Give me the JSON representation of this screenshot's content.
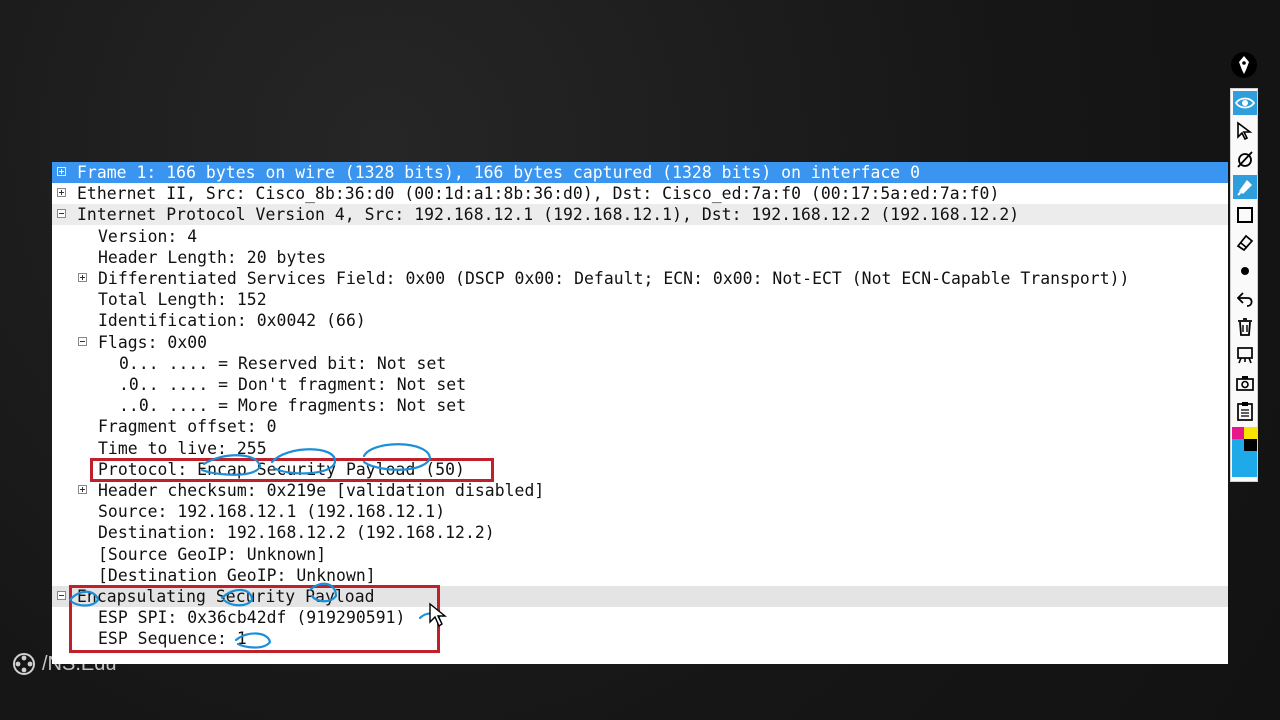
{
  "packet_details": {
    "rows": [
      {
        "text": "Frame 1: 166 bytes on wire (1328 bits), 166 bytes captured (1328 bits) on interface 0",
        "expander": "plus"
      },
      {
        "text": "Ethernet II, Src: Cisco_8b:36:d0 (00:1d:a1:8b:36:d0), Dst: Cisco_ed:7a:f0 (00:17:5a:ed:7a:f0)",
        "expander": "plus"
      },
      {
        "text": "Internet Protocol Version 4, Src: 192.168.12.1 (192.168.12.1), Dst: 192.168.12.2 (192.168.12.2)",
        "expander": "minus"
      },
      {
        "text": "Version: 4",
        "expander": "none"
      },
      {
        "text": "Header Length: 20 bytes",
        "expander": "none"
      },
      {
        "text": "Differentiated Services Field: 0x00 (DSCP 0x00: Default; ECN: 0x00: Not-ECT (Not ECN-Capable Transport))",
        "expander": "plus"
      },
      {
        "text": "Total Length: 152",
        "expander": "none"
      },
      {
        "text": "Identification: 0x0042 (66)",
        "expander": "none"
      },
      {
        "text": "Flags: 0x00",
        "expander": "minus"
      },
      {
        "text": "0... .... = Reserved bit: Not set",
        "expander": "none"
      },
      {
        "text": ".0.. .... = Don't fragment: Not set",
        "expander": "none"
      },
      {
        "text": "..0. .... = More fragments: Not set",
        "expander": "none"
      },
      {
        "text": "Fragment offset: 0",
        "expander": "none"
      },
      {
        "text": "Time to live: 255",
        "expander": "none"
      },
      {
        "text": "Protocol: Encap Security Payload (50)",
        "expander": "none"
      },
      {
        "text": "Header checksum: 0x219e [validation disabled]",
        "expander": "plus"
      },
      {
        "text": "Source: 192.168.12.1 (192.168.12.1)",
        "expander": "none"
      },
      {
        "text": "Destination: 192.168.12.2 (192.168.12.2)",
        "expander": "none"
      },
      {
        "text": "[Source GeoIP: Unknown]",
        "expander": "none"
      },
      {
        "text": "[Destination GeoIP: Unknown]",
        "expander": "none"
      },
      {
        "text": "Encapsulating Security Payload",
        "expander": "minus"
      },
      {
        "text": "ESP SPI: 0x36cb42df (919290591)",
        "expander": "none"
      },
      {
        "text": "ESP Sequence: 1",
        "expander": "none"
      }
    ]
  },
  "annotation_toolbar": {
    "tools": [
      "pen-icon",
      "eye-icon",
      "cursor-arrow-icon",
      "eraser-off-icon",
      "highlighter-icon",
      "rectangle-icon",
      "eraser-icon",
      "dot-icon",
      "undo-icon",
      "trash-icon",
      "whiteboard-icon",
      "camera-icon",
      "clipboard-icon",
      "color-palette-icon"
    ],
    "active_tools": [
      "eye-icon",
      "highlighter-icon"
    ],
    "accent": "#2f9edc",
    "palette": [
      "#e8168a",
      "#f7e400",
      "#1ea9e8",
      "#000000"
    ]
  },
  "watermark": {
    "text": "/NS.Edu"
  },
  "colors": {
    "selection": "#3a95f0",
    "highlight_box": "#c0202a",
    "ink": "#1a8fd8"
  }
}
